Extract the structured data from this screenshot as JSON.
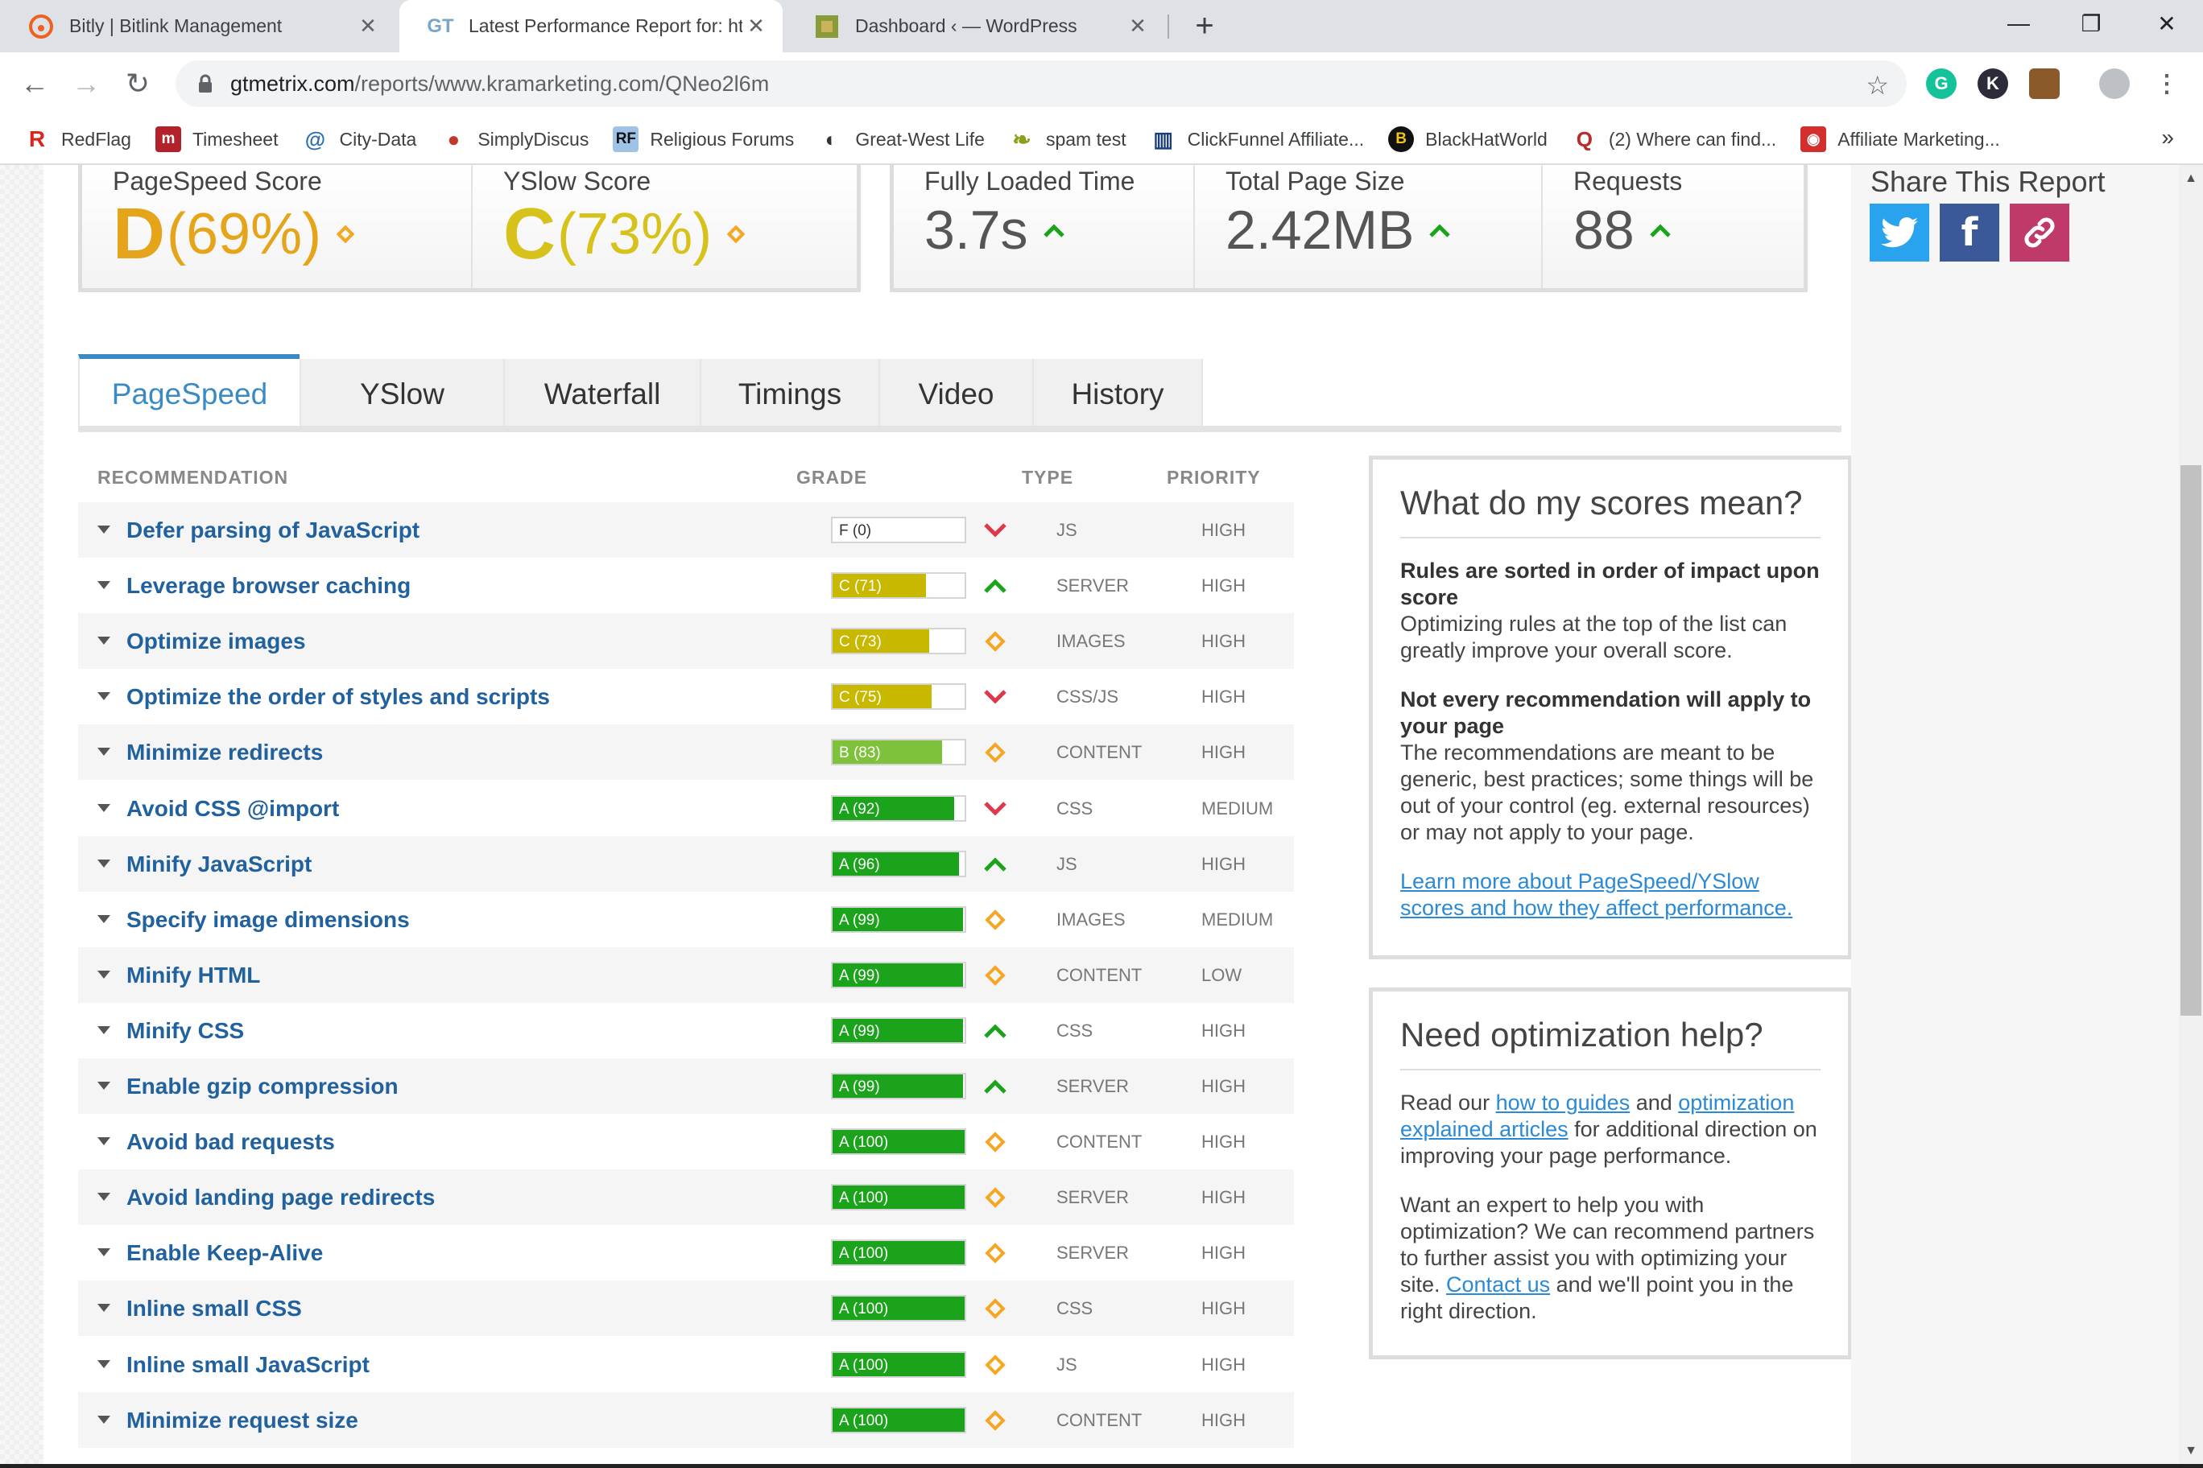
{
  "browser": {
    "tabs": [
      {
        "title": "Bitly | Bitlink Management",
        "icon": "bitly-icon"
      },
      {
        "title": "Latest Performance Report for: ht",
        "icon": "gtmetrix-icon",
        "active": true
      },
      {
        "title": "Dashboard ‹ — WordPress",
        "icon": "wordpress-icon"
      }
    ],
    "new_tab": "+",
    "url_host": "gtmetrix.com",
    "url_path": "/reports/www.kramarketing.com/QNeo2l6m",
    "bookmarks": [
      {
        "label": "RedFlag",
        "icon": "R"
      },
      {
        "label": "Timesheet",
        "icon": "m"
      },
      {
        "label": "City-Data",
        "icon": "@"
      },
      {
        "label": "SimplyDiscus",
        "icon": "●"
      },
      {
        "label": "Religious Forums",
        "icon": "RF"
      },
      {
        "label": "Great-West Life",
        "icon": "◐"
      },
      {
        "label": "spam test",
        "icon": "❧"
      },
      {
        "label": "ClickFunnel Affiliate...",
        "icon": "▥"
      },
      {
        "label": "BlackHatWorld",
        "icon": "B"
      },
      {
        "label": "(2) Where can find...",
        "icon": "Q"
      },
      {
        "label": "Affiliate Marketing...",
        "icon": "◉"
      }
    ],
    "more": "»"
  },
  "scores": {
    "pagespeed": {
      "label": "PageSpeed Score",
      "grade": "D",
      "pct": "(69%)",
      "color": "#e5a41a"
    },
    "yslow": {
      "label": "YSlow Score",
      "grade": "C",
      "pct": "(73%)",
      "color": "#d6c21a"
    }
  },
  "metrics": {
    "loaded": {
      "label": "Fully Loaded Time",
      "value": "3.7s"
    },
    "size": {
      "label": "Total Page Size",
      "value": "2.42MB"
    },
    "requests": {
      "label": "Requests",
      "value": "88"
    }
  },
  "share": {
    "title": "Share This Report"
  },
  "page_tabs": [
    "PageSpeed",
    "YSlow",
    "Waterfall",
    "Timings",
    "Video",
    "History"
  ],
  "table": {
    "headers": {
      "recommendation": "RECOMMENDATION",
      "grade": "GRADE",
      "type": "TYPE",
      "priority": "PRIORITY"
    },
    "rows": [
      {
        "name": "Defer parsing of JavaScript",
        "grade": "F (0)",
        "score": 0,
        "trend": "down",
        "type": "JS",
        "priority": "HIGH"
      },
      {
        "name": "Leverage browser caching",
        "grade": "C (71)",
        "score": 71,
        "trend": "up",
        "type": "SERVER",
        "priority": "HIGH"
      },
      {
        "name": "Optimize images",
        "grade": "C (73)",
        "score": 73,
        "trend": "same",
        "type": "IMAGES",
        "priority": "HIGH"
      },
      {
        "name": "Optimize the order of styles and scripts",
        "grade": "C (75)",
        "score": 75,
        "trend": "down",
        "type": "CSS/JS",
        "priority": "HIGH"
      },
      {
        "name": "Minimize redirects",
        "grade": "B (83)",
        "score": 83,
        "trend": "same",
        "type": "CONTENT",
        "priority": "HIGH"
      },
      {
        "name": "Avoid CSS @import",
        "grade": "A (92)",
        "score": 92,
        "trend": "down",
        "type": "CSS",
        "priority": "MEDIUM"
      },
      {
        "name": "Minify JavaScript",
        "grade": "A (96)",
        "score": 96,
        "trend": "up",
        "type": "JS",
        "priority": "HIGH"
      },
      {
        "name": "Specify image dimensions",
        "grade": "A (99)",
        "score": 99,
        "trend": "same",
        "type": "IMAGES",
        "priority": "MEDIUM"
      },
      {
        "name": "Minify HTML",
        "grade": "A (99)",
        "score": 99,
        "trend": "same",
        "type": "CONTENT",
        "priority": "LOW"
      },
      {
        "name": "Minify CSS",
        "grade": "A (99)",
        "score": 99,
        "trend": "up",
        "type": "CSS",
        "priority": "HIGH"
      },
      {
        "name": "Enable gzip compression",
        "grade": "A (99)",
        "score": 99,
        "trend": "up",
        "type": "SERVER",
        "priority": "HIGH"
      },
      {
        "name": "Avoid bad requests",
        "grade": "A (100)",
        "score": 100,
        "trend": "same",
        "type": "CONTENT",
        "priority": "HIGH"
      },
      {
        "name": "Avoid landing page redirects",
        "grade": "A (100)",
        "score": 100,
        "trend": "same",
        "type": "SERVER",
        "priority": "HIGH"
      },
      {
        "name": "Enable Keep-Alive",
        "grade": "A (100)",
        "score": 100,
        "trend": "same",
        "type": "SERVER",
        "priority": "HIGH"
      },
      {
        "name": "Inline small CSS",
        "grade": "A (100)",
        "score": 100,
        "trend": "same",
        "type": "CSS",
        "priority": "HIGH"
      },
      {
        "name": "Inline small JavaScript",
        "grade": "A (100)",
        "score": 100,
        "trend": "same",
        "type": "JS",
        "priority": "HIGH"
      },
      {
        "name": "Minimize request size",
        "grade": "A (100)",
        "score": 100,
        "trend": "same",
        "type": "CONTENT",
        "priority": "HIGH"
      }
    ]
  },
  "scores_box": {
    "title": "What do my scores mean?",
    "p1_bold": "Rules are sorted in order of impact upon score",
    "p1": "Optimizing rules at the top of the list can greatly improve your overall score.",
    "p2_bold": "Not every recommendation will apply to your page",
    "p2": "The recommendations are meant to be generic, best practices; some things will be out of your control (eg. external resources) or may not apply to your page.",
    "link": "Learn more about PageSpeed/YSlow scores and how they affect performance."
  },
  "help_box": {
    "title": "Need optimization help?",
    "p1_a": "Read our ",
    "p1_link1": "how to guides",
    "p1_b": " and ",
    "p1_link2": "optimization explained articles",
    "p1_c": " for additional direction on improving your page performance.",
    "p2_a": "Want an expert to help you with optimization? We can recommend partners to further assist you with optimizing your site. ",
    "p2_link": "Contact us",
    "p2_b": " and we'll point you in the right direction."
  },
  "colors": {
    "grade_a": "#1ca31c",
    "grade_b": "#7ec13a",
    "grade_c": "#c9b800",
    "accent": "#3a8bc4",
    "link": "#21619e"
  }
}
